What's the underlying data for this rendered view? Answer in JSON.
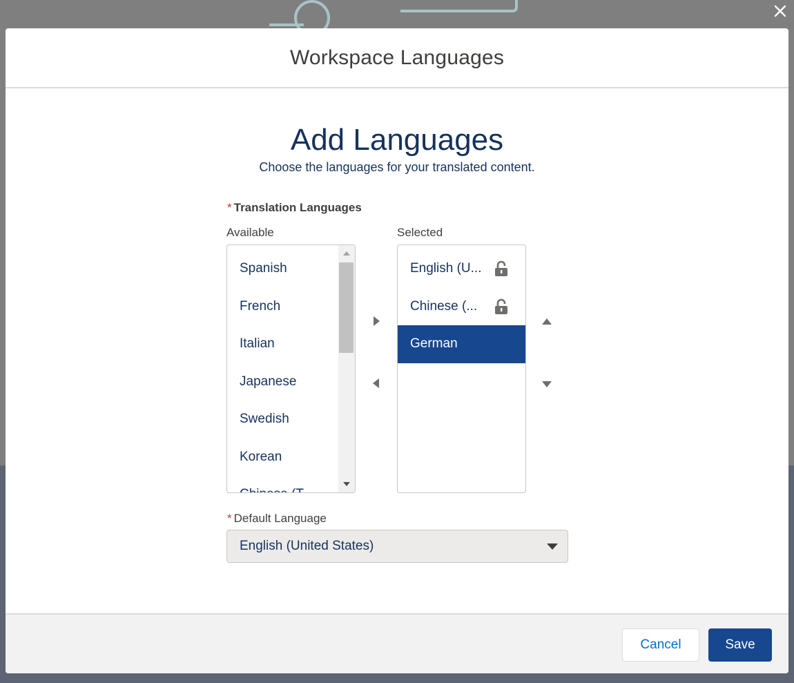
{
  "modal": {
    "title": "Workspace Languages"
  },
  "content": {
    "heading": "Add Languages",
    "subheading": "Choose the languages for your translated content."
  },
  "translation": {
    "required_marker": "*",
    "label": "Translation Languages",
    "available_label": "Available",
    "selected_label": "Selected",
    "available": [
      {
        "label": "Spanish"
      },
      {
        "label": "French"
      },
      {
        "label": "Italian"
      },
      {
        "label": "Japanese"
      },
      {
        "label": "Swedish"
      },
      {
        "label": "Korean"
      },
      {
        "label": "Chinese (T"
      }
    ],
    "selected": [
      {
        "label": "English (U...",
        "locked": true,
        "icon": "lock-icon"
      },
      {
        "label": "Chinese (...",
        "locked": true,
        "icon": "lock-icon"
      },
      {
        "label": "German",
        "locked": false,
        "highlighted": true
      }
    ]
  },
  "default_language": {
    "required_marker": "*",
    "label": "Default Language",
    "value": "English (United States)"
  },
  "footer": {
    "cancel_label": "Cancel",
    "save_label": "Save"
  },
  "icons": {
    "close": "close-icon",
    "move_right": "move-right-icon",
    "move_left": "move-left-icon",
    "move_up": "move-up-icon",
    "move_down": "move-down-icon",
    "lock": "lock-icon",
    "dropdown": "chevron-down-icon"
  },
  "colors": {
    "brand_blue": "#16478f",
    "link_blue": "#0070d2",
    "text_dark": "#16325c",
    "required_red": "#c23934"
  }
}
